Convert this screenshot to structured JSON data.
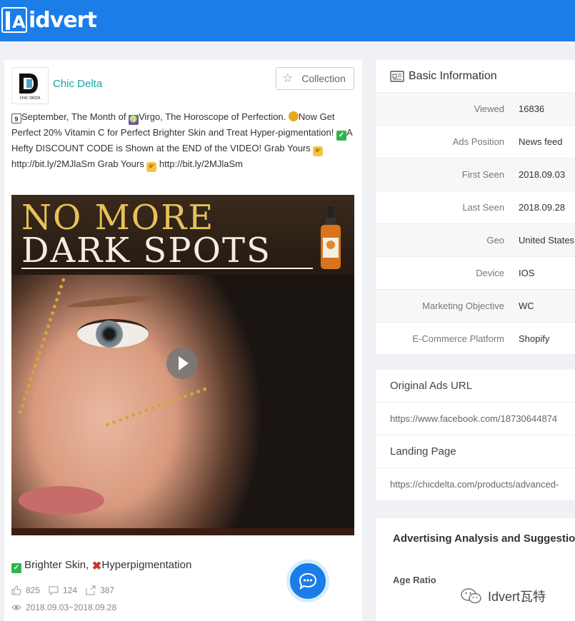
{
  "header": {
    "logo_text": "idvert",
    "logo_mark": "iA"
  },
  "ad": {
    "brand_name": "Chic Delta",
    "brand_logo_text": "CHIC DELTA",
    "collection_label": "Collection",
    "text_segments": {
      "t1": "September, The Month of ",
      "t2": "Virgo, The Horoscope of Perfection. ",
      "t3": "Now Get Perfect 20% Vitamin C for Perfect Brighter Skin and Treat Hyper-pigmentation! ",
      "t4": "A Hefty DISCOUNT CODE is Shown at the END of the VIDEO! Grab Yours ",
      "t5": " http://bit.ly/2MJlaSm Grab Yours ",
      "t6": " http://bit.ly/2MJlaSm"
    },
    "emoji_cal": "9",
    "emoji_virgo": "♍",
    "media": {
      "headline_line1": "NO MORE",
      "headline_line2": "DARK SPOTS"
    },
    "caption_part1": "Brighter Skin, ",
    "caption_part2": "Hyperpigmentation",
    "likes": "825",
    "comments": "124",
    "shares": "387",
    "date_range": "2018.09.03~2018.09.28"
  },
  "basic_info": {
    "title": "Basic Information",
    "rows": [
      {
        "label": "Viewed",
        "value": "16836"
      },
      {
        "label": "Ads Position",
        "value": "News feed"
      },
      {
        "label": "First Seen",
        "value": "2018.09.03"
      },
      {
        "label": "Last Seen",
        "value": "2018.09.28"
      },
      {
        "label": "Geo",
        "value": "United States"
      },
      {
        "label": "Device",
        "value": "IOS"
      },
      {
        "label": "Marketing Objective",
        "value": "WC"
      },
      {
        "label": "E-Commerce Platform",
        "value": "Shopify"
      }
    ]
  },
  "urls": {
    "original_title": "Original Ads URL",
    "original_value": "https://www.facebook.com/18730644874",
    "landing_title": "Landing Page",
    "landing_value": "https://chicdelta.com/products/advanced-"
  },
  "analysis": {
    "title": "Advertising Analysis and Suggestions",
    "age_ratio_label": "Age Ratio"
  },
  "watermark": {
    "text": "Idvert瓦特"
  },
  "colors": {
    "brand_blue": "#1a7de8",
    "brand_teal": "#1aa4a8"
  }
}
